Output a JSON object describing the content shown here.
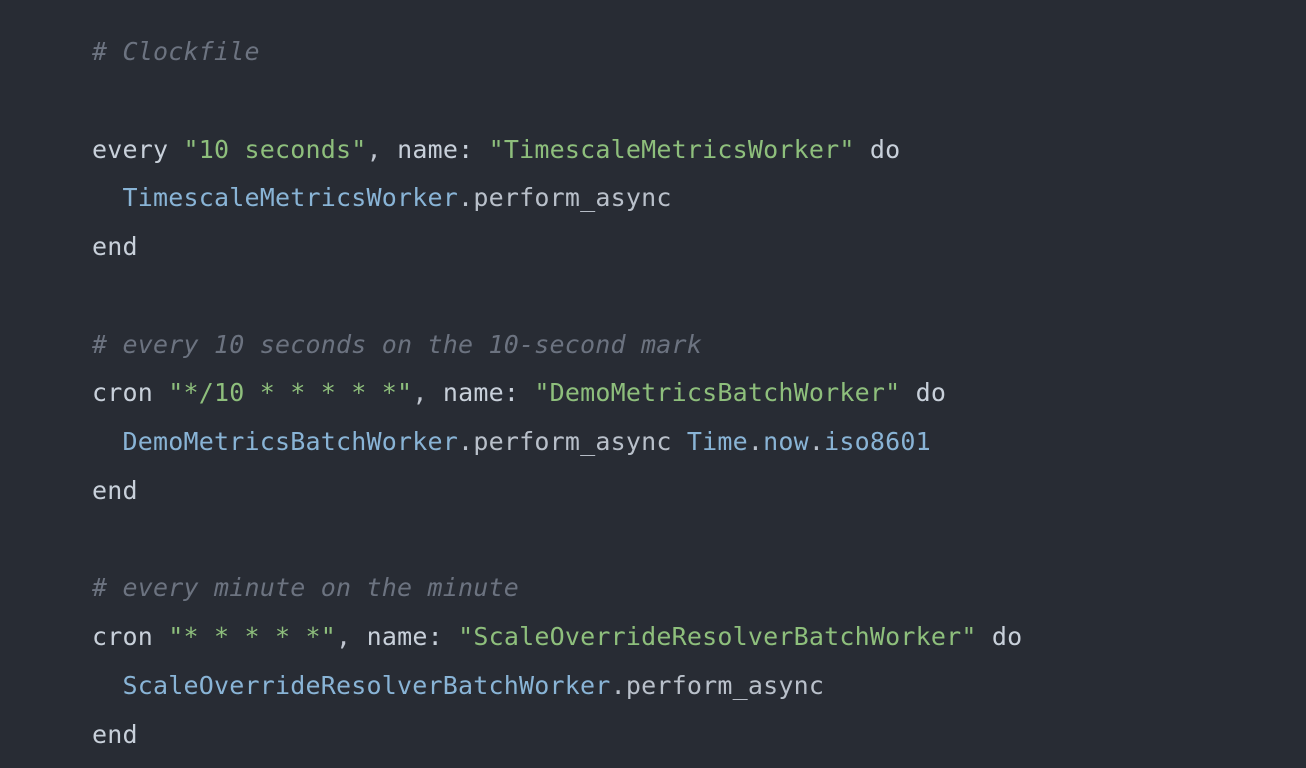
{
  "code": {
    "comments": {
      "clockfile": "# Clockfile",
      "ten_sec_mark": "# every 10 seconds on the 10-second mark",
      "every_minute": "# every minute on the minute"
    },
    "keywords": {
      "every": "every",
      "cron": "cron",
      "name": "name:",
      "do": "do",
      "end": "end"
    },
    "strings": {
      "ten_seconds": "\"10 seconds\"",
      "timescale_name": "\"TimescaleMetricsWorker\"",
      "cron_ten": "\"*/10 * * * * *\"",
      "demo_name": "\"DemoMetricsBatchWorker\"",
      "cron_minute": "\"* * * * *\"",
      "scale_name": "\"ScaleOverrideResolverBatchWorker\""
    },
    "consts": {
      "timescale_worker": "TimescaleMetricsWorker",
      "demo_worker": "DemoMetricsBatchWorker",
      "time": "Time",
      "now": "now",
      "iso8601": "iso8601",
      "scale_worker": "ScaleOverrideResolverBatchWorker"
    },
    "methods": {
      "perform_async": "perform_async"
    },
    "punct": {
      "comma_space": ", ",
      "space": " ",
      "dot": "."
    },
    "indent": "  "
  }
}
